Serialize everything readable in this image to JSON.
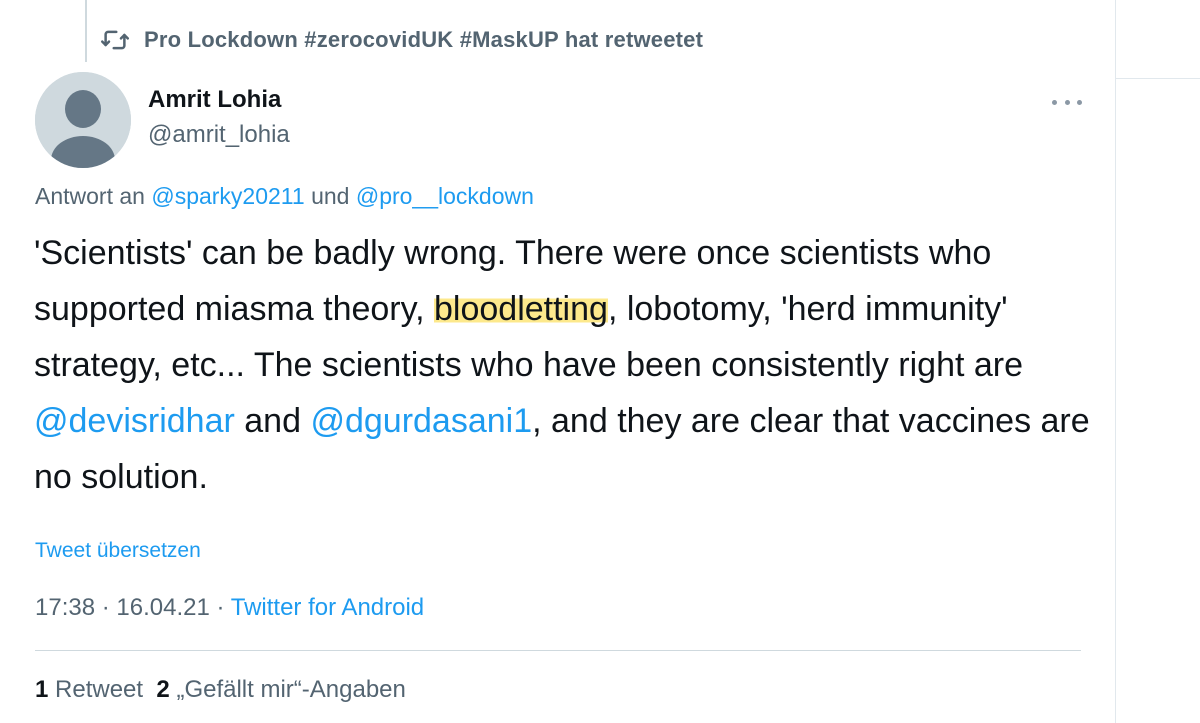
{
  "retweet": {
    "icon": "retweet-icon",
    "text": "Pro Lockdown #zerocovidUK #MaskUP hat retweetet"
  },
  "author": {
    "avatar_icon": "default-avatar-icon",
    "name": "Amrit Lohia",
    "handle": "@amrit_lohia"
  },
  "more_icon": "more-options-icon",
  "reply": {
    "prefix": "Antwort an",
    "mention1": "@sparky20211",
    "joiner": "und",
    "mention2": "@pro__lockdown"
  },
  "tweet": {
    "part1": "'Scientists' can be badly wrong. There were once scientists who supported miasma theory,",
    "highlighted": "bloodletting",
    "part2": ", lobotomy, 'herd immunity' strategy, etc... The scientists who have been consistently right are",
    "mention_a": "@devisridhar",
    "and": "and",
    "mention_b": "@dgurdasani1",
    "part3": ", and they are clear that vaccines are no solution."
  },
  "translate_label": "Tweet übersetzen",
  "meta": {
    "time": "17:38",
    "date": "16.04.21",
    "separator": "·",
    "source": "Twitter for Android"
  },
  "stats": {
    "retweet_count": "1",
    "retweet_label": "Retweet",
    "like_count": "2",
    "like_label": "„Gefällt mir“-Angaben"
  },
  "colors": {
    "accent": "#1d9bf0",
    "muted": "#536471",
    "highlight": "#fde98c"
  }
}
